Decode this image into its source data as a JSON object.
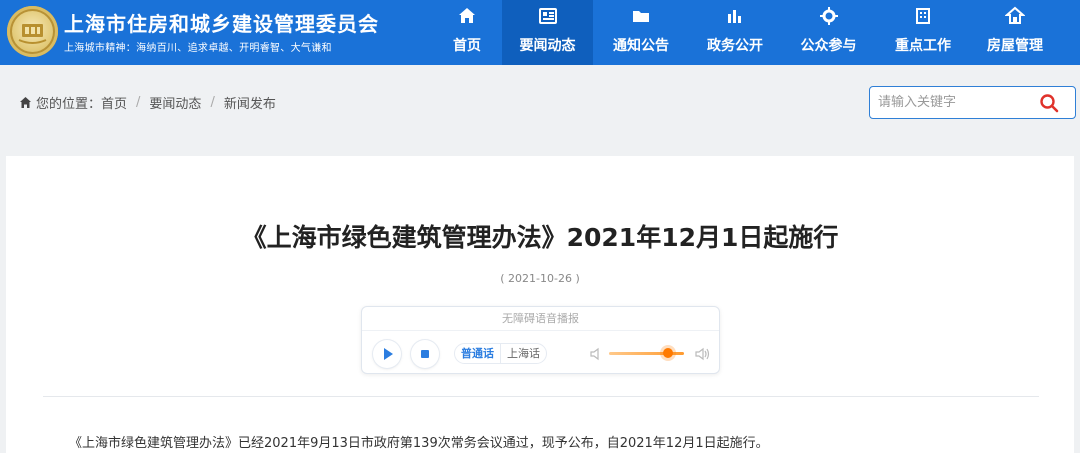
{
  "header": {
    "site_title": "上海市住房和城乡建设管理委员会",
    "slogan": "上海城市精神：海纳百川、追求卓越、开明睿智、大气谦和",
    "brand_color": "#1a72d8"
  },
  "nav": {
    "items": [
      {
        "label": "首页",
        "icon": "home-icon"
      },
      {
        "label": "要闻动态",
        "icon": "news-icon",
        "active": true
      },
      {
        "label": "通知公告",
        "icon": "folder-icon"
      },
      {
        "label": "政务公开",
        "icon": "chart-icon"
      },
      {
        "label": "公众参与",
        "icon": "gear-icon"
      },
      {
        "label": "重点工作",
        "icon": "building-icon"
      },
      {
        "label": "房屋管理",
        "icon": "house-icon"
      }
    ]
  },
  "breadcrumb": {
    "prefix": "您的位置：",
    "items": [
      "首页",
      "要闻动态",
      "新闻发布"
    ],
    "separator": "/"
  },
  "search": {
    "placeholder": "请输入关键字"
  },
  "article": {
    "title": "《上海市绿色建筑管理办法》2021年12月1日起施行",
    "date": "( 2021-10-26 )",
    "body": "《上海市绿色建筑管理办法》已经2021年9月13日市政府第139次常务会议通过，现予公布，自2021年12月1日起施行。"
  },
  "player": {
    "title": "无障碍语音播报",
    "lang_options": [
      "普通话",
      "上海话"
    ],
    "selected_lang": "普通话",
    "volume_level": 0.78,
    "accent_color": "#2b7de0",
    "volume_color": "#ff7a00"
  }
}
